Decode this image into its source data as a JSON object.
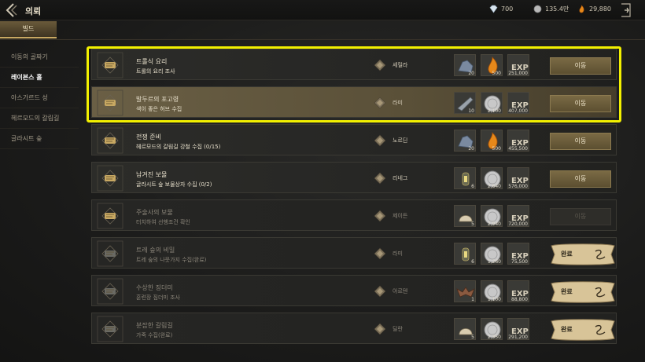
{
  "header": {
    "title": "의뢰",
    "crystal": "700",
    "silver": "135.4만",
    "gold": "29,880"
  },
  "guild_tab": "빌드",
  "sidebar": {
    "items": [
      {
        "label": "이동의 골짜기"
      },
      {
        "label": "레이븐스 홀"
      },
      {
        "label": "아스가르드 성"
      },
      {
        "label": "헤르모드의 갈림길"
      },
      {
        "label": "글라시트 숲"
      }
    ]
  },
  "quests": [
    {
      "name": "트롤식 요리",
      "desc": "트롤의 요리 조사",
      "npc": "세릴라",
      "rewards": [
        {
          "icon": "ore-icon",
          "count": "20"
        },
        {
          "icon": "amber-gem-icon",
          "count": "500"
        },
        {
          "icon": "exp-icon",
          "count": "251,000"
        }
      ],
      "action": "이동"
    },
    {
      "name": "발두르의 포고령",
      "desc": "색이 좋은 허브 수집",
      "npc": "라미",
      "rewards": [
        {
          "icon": "blade-icon",
          "count": "10"
        },
        {
          "icon": "silver-coin-icon",
          "count": "2,100"
        },
        {
          "icon": "exp-icon",
          "count": "407,000"
        }
      ],
      "action": "이동"
    },
    {
      "name": "전쟁 준비",
      "desc": "헤르모드의 갈림길 강철 수집 (0/15)",
      "npc": "노르딘",
      "rewards": [
        {
          "icon": "ore-icon",
          "count": "20"
        },
        {
          "icon": "amber-gem-icon",
          "count": "500"
        },
        {
          "icon": "exp-icon",
          "count": "455,500"
        }
      ],
      "action": "이동"
    },
    {
      "name": "남겨진 보물",
      "desc": "글라시트 숲 보물상자 수집 (0/2)",
      "npc": "리네그",
      "rewards": [
        {
          "icon": "lantern-icon",
          "count": "6"
        },
        {
          "icon": "silver-coin-icon",
          "count": "2,640"
        },
        {
          "icon": "exp-icon",
          "count": "576,000"
        }
      ],
      "action": "이동"
    },
    {
      "name": "주술사의 보물",
      "desc": "터치하여 선행조건 확인",
      "npc": "제이든",
      "rewards": [
        {
          "icon": "shell-icon",
          "count": "5"
        },
        {
          "icon": "silver-coin-icon",
          "count": "2,940"
        },
        {
          "icon": "exp-icon",
          "count": "720,000"
        }
      ],
      "action": "이동"
    },
    {
      "name": "트레 숲의 비밀",
      "desc": "트레 숲의 나뭇가지 수집(완료)",
      "npc": "라미",
      "rewards": [
        {
          "icon": "lantern-icon",
          "count": "6"
        },
        {
          "icon": "silver-coin-icon",
          "count": "1,260"
        },
        {
          "icon": "exp-icon",
          "count": "75,500"
        }
      ],
      "action": "완료"
    },
    {
      "name": "수상한 징더미",
      "desc": "훈련장 짐더미 조사",
      "npc": "아르텐",
      "rewards": [
        {
          "icon": "bat-icon",
          "count": "1"
        },
        {
          "icon": "silver-coin-icon",
          "count": "1,100"
        },
        {
          "icon": "exp-icon",
          "count": "88,800"
        }
      ],
      "action": "완료"
    },
    {
      "name": "분잡한 갈림길",
      "desc": "가죽 수집(완료)",
      "npc": "딜란",
      "rewards": [
        {
          "icon": "shell-icon",
          "count": "5"
        },
        {
          "icon": "silver-coin-icon",
          "count": "2,350"
        },
        {
          "icon": "exp-icon",
          "count": "291,200"
        }
      ],
      "action": "완료"
    }
  ],
  "colors": {
    "accent": "#c8a862",
    "selection": "#f2f000"
  }
}
